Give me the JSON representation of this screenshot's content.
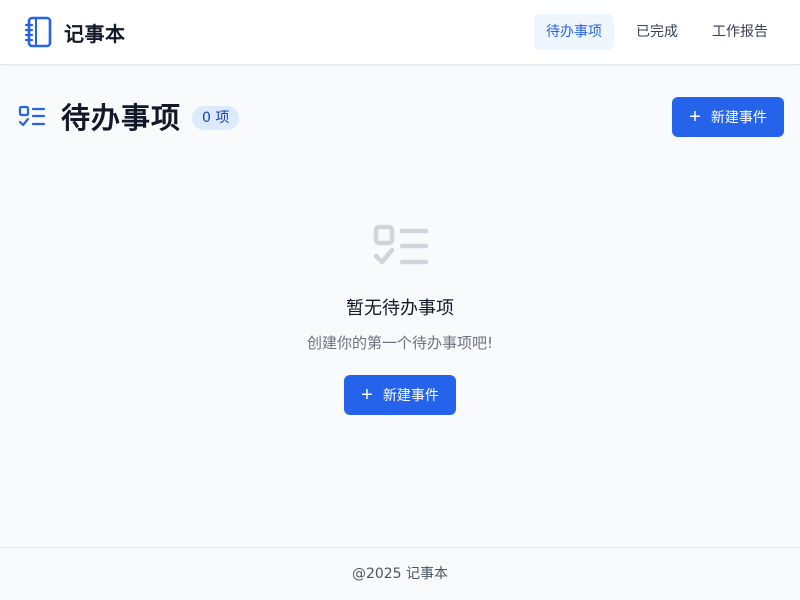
{
  "header": {
    "brand_title": "记事本",
    "brand_icon": "notebook-icon",
    "nav": [
      {
        "label": "待办事项",
        "active": true
      },
      {
        "label": "已完成",
        "active": false
      },
      {
        "label": "工作报告",
        "active": false
      }
    ]
  },
  "main": {
    "title_icon": "checklist-icon",
    "title": "待办事项",
    "count_badge": "0 项",
    "new_button_label": "新建事件"
  },
  "empty_state": {
    "icon": "checklist-icon",
    "title": "暂无待办事项",
    "subtitle": "创建你的第一个待办事项吧!",
    "button_label": "新建事件"
  },
  "footer": {
    "text": "@2025 记事本"
  },
  "colors": {
    "primary": "#2563eb",
    "primary_light": "#eff6ff",
    "badge_bg": "#dbeafe",
    "page_bg": "#f8fafc",
    "empty_icon": "#d1d5db"
  }
}
